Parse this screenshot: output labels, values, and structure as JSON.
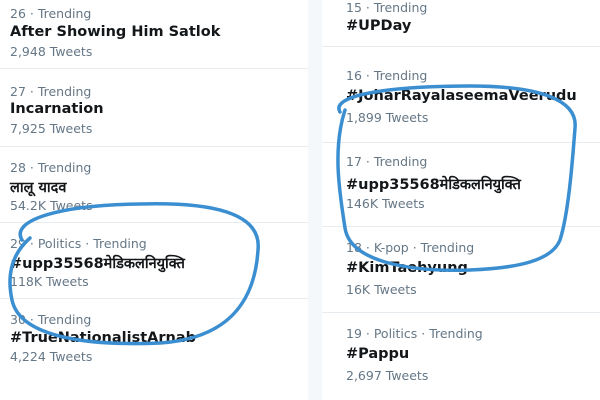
{
  "left_panel": {
    "trends": [
      {
        "meta": "26 · Trending",
        "name": "After Showing Him Satlok",
        "count": "2,948 Tweets"
      },
      {
        "meta": "27 · Trending",
        "name": "Incarnation",
        "count": "7,925 Tweets"
      },
      {
        "meta": "28 · Trending",
        "name": "लालू यादव",
        "count": "54.2K Tweets"
      },
      {
        "meta": "29 · Politics · Trending",
        "name": "#upp35568मेडिकलनियुक्ति",
        "count": "118K Tweets"
      },
      {
        "meta": "30 · Trending",
        "name": "#TrueNationalistArnab",
        "count": "4,224 Tweets"
      }
    ]
  },
  "right_panel": {
    "trends": [
      {
        "meta": "15 · Trending",
        "name": "#UPDay",
        "count": ""
      },
      {
        "meta": "16 · Trending",
        "name": "#JoharRayalaseemaVeerudu",
        "count": "1,899 Tweets"
      },
      {
        "meta": "17 · Trending",
        "name": "#upp35568मेडिकलनियुक्ति",
        "count": "146K Tweets"
      },
      {
        "meta": "18 · K-pop · Trending",
        "name": "#KimTaehyung",
        "count": "16K Tweets"
      },
      {
        "meta": "19 · Politics · Trending",
        "name": "#Pappu",
        "count": "2,697 Tweets"
      }
    ]
  },
  "colors": {
    "annotation_stroke": "#3b8fd1",
    "meta_text": "#657786",
    "name_text": "#14171a"
  }
}
